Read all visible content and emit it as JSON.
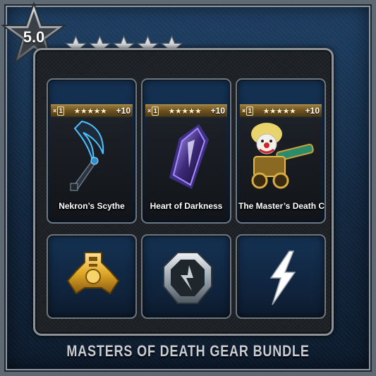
{
  "rating": {
    "value": "5.0",
    "stars": 5
  },
  "items": [
    {
      "rank_label": "1",
      "stars": "★★★★★",
      "plus": "+10",
      "name": "Nekron’s Scythe",
      "icon": "scythe-icon"
    },
    {
      "rank_label": "1",
      "stars": "★★★★★",
      "plus": "+10",
      "name": "Heart of Darkness",
      "icon": "crystal-icon"
    },
    {
      "rank_label": "1",
      "stars": "★★★★★",
      "plus": "+10",
      "name": "The Master’s Death Cart",
      "icon": "clown-cart-icon"
    }
  ],
  "class_icons": [
    {
      "icon": "gold-tri-emblem-icon"
    },
    {
      "icon": "silver-shield-emblem-icon"
    },
    {
      "icon": "lightning-bolt-icon"
    }
  ],
  "bundle": {
    "title": "MASTERS OF DEATH GEAR BUNDLE"
  },
  "colors": {
    "card_blue": "#153254",
    "gold": "#e0b23a",
    "silver": "#aeb7bf"
  }
}
